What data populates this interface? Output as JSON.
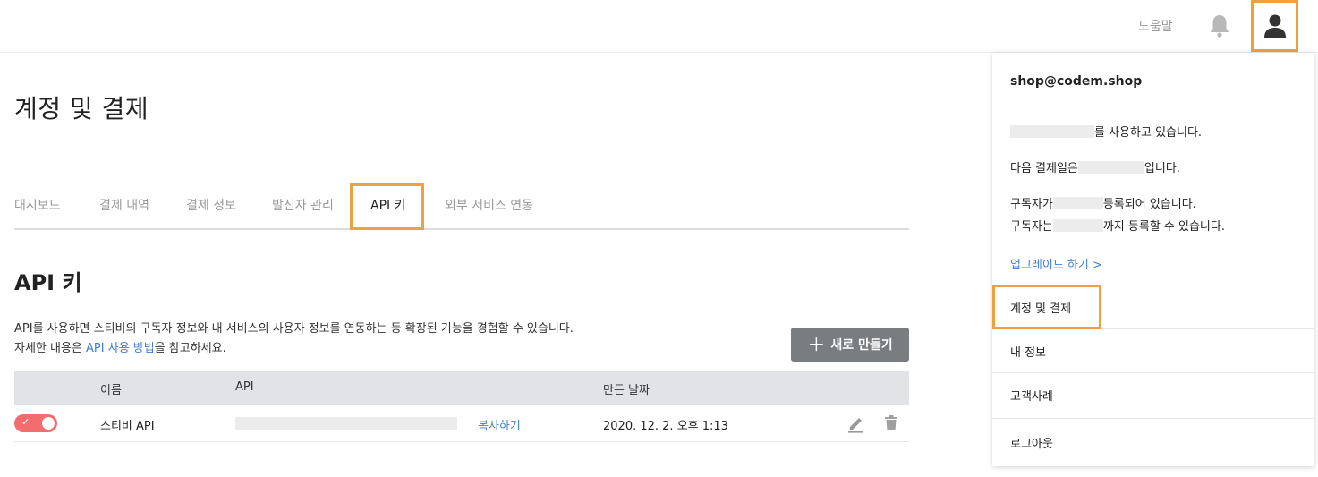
{
  "header": {
    "help_label": "도움말",
    "bell_icon": "bell-icon",
    "profile_icon": "user-icon"
  },
  "page": {
    "title": "계정 및 결제"
  },
  "tabs": [
    {
      "label": "대시보드",
      "active": false
    },
    {
      "label": "결제 내역",
      "active": false
    },
    {
      "label": "결제 정보",
      "active": false
    },
    {
      "label": "발신자 관리",
      "active": false
    },
    {
      "label": "API 키",
      "active": true
    },
    {
      "label": "외부 서비스 연동",
      "active": false
    }
  ],
  "api_section": {
    "title": "API 키",
    "desc_line1": "API를 사용하면 스티비의 구독자 정보와 내 서비스의 사용자 정보를 연동하는 등 확장된 기능을 경험할 수 있습니다.",
    "desc_line2_prefix": "자세한 내용은 ",
    "desc_link": "API 사용 방법",
    "desc_line2_suffix": "을 참고하세요.",
    "new_button_label": "새로 만들기",
    "table": {
      "headers": {
        "name": "이름",
        "api": "API",
        "created": "만든 날짜"
      },
      "rows": [
        {
          "enabled": true,
          "name": "스티비 API",
          "copy_label": "복사하기",
          "created": "2020. 12. 2. 오후 1:13"
        }
      ]
    }
  },
  "dropdown": {
    "email": "shop@codem.shop",
    "plan_suffix": "를 사용하고 있습니다.",
    "next_payment_prefix": "다음 결제일은",
    "next_payment_suffix": "입니다.",
    "subscribers_prefix": "구독자가",
    "subscribers_suffix": "등록되어 있습니다.",
    "limit_prefix": "구독자는",
    "limit_suffix": "까지 등록할 수 있습니다.",
    "upgrade_label": "업그레이드 하기 >",
    "menu": [
      "계정 및 결제",
      "내 정보",
      "고객사례",
      "로그아웃"
    ]
  },
  "colors": {
    "accent": "#3d7fd6",
    "highlight": "#f0a040",
    "toggle_on": "#f26d6d",
    "button_bg": "#7a7d80"
  }
}
